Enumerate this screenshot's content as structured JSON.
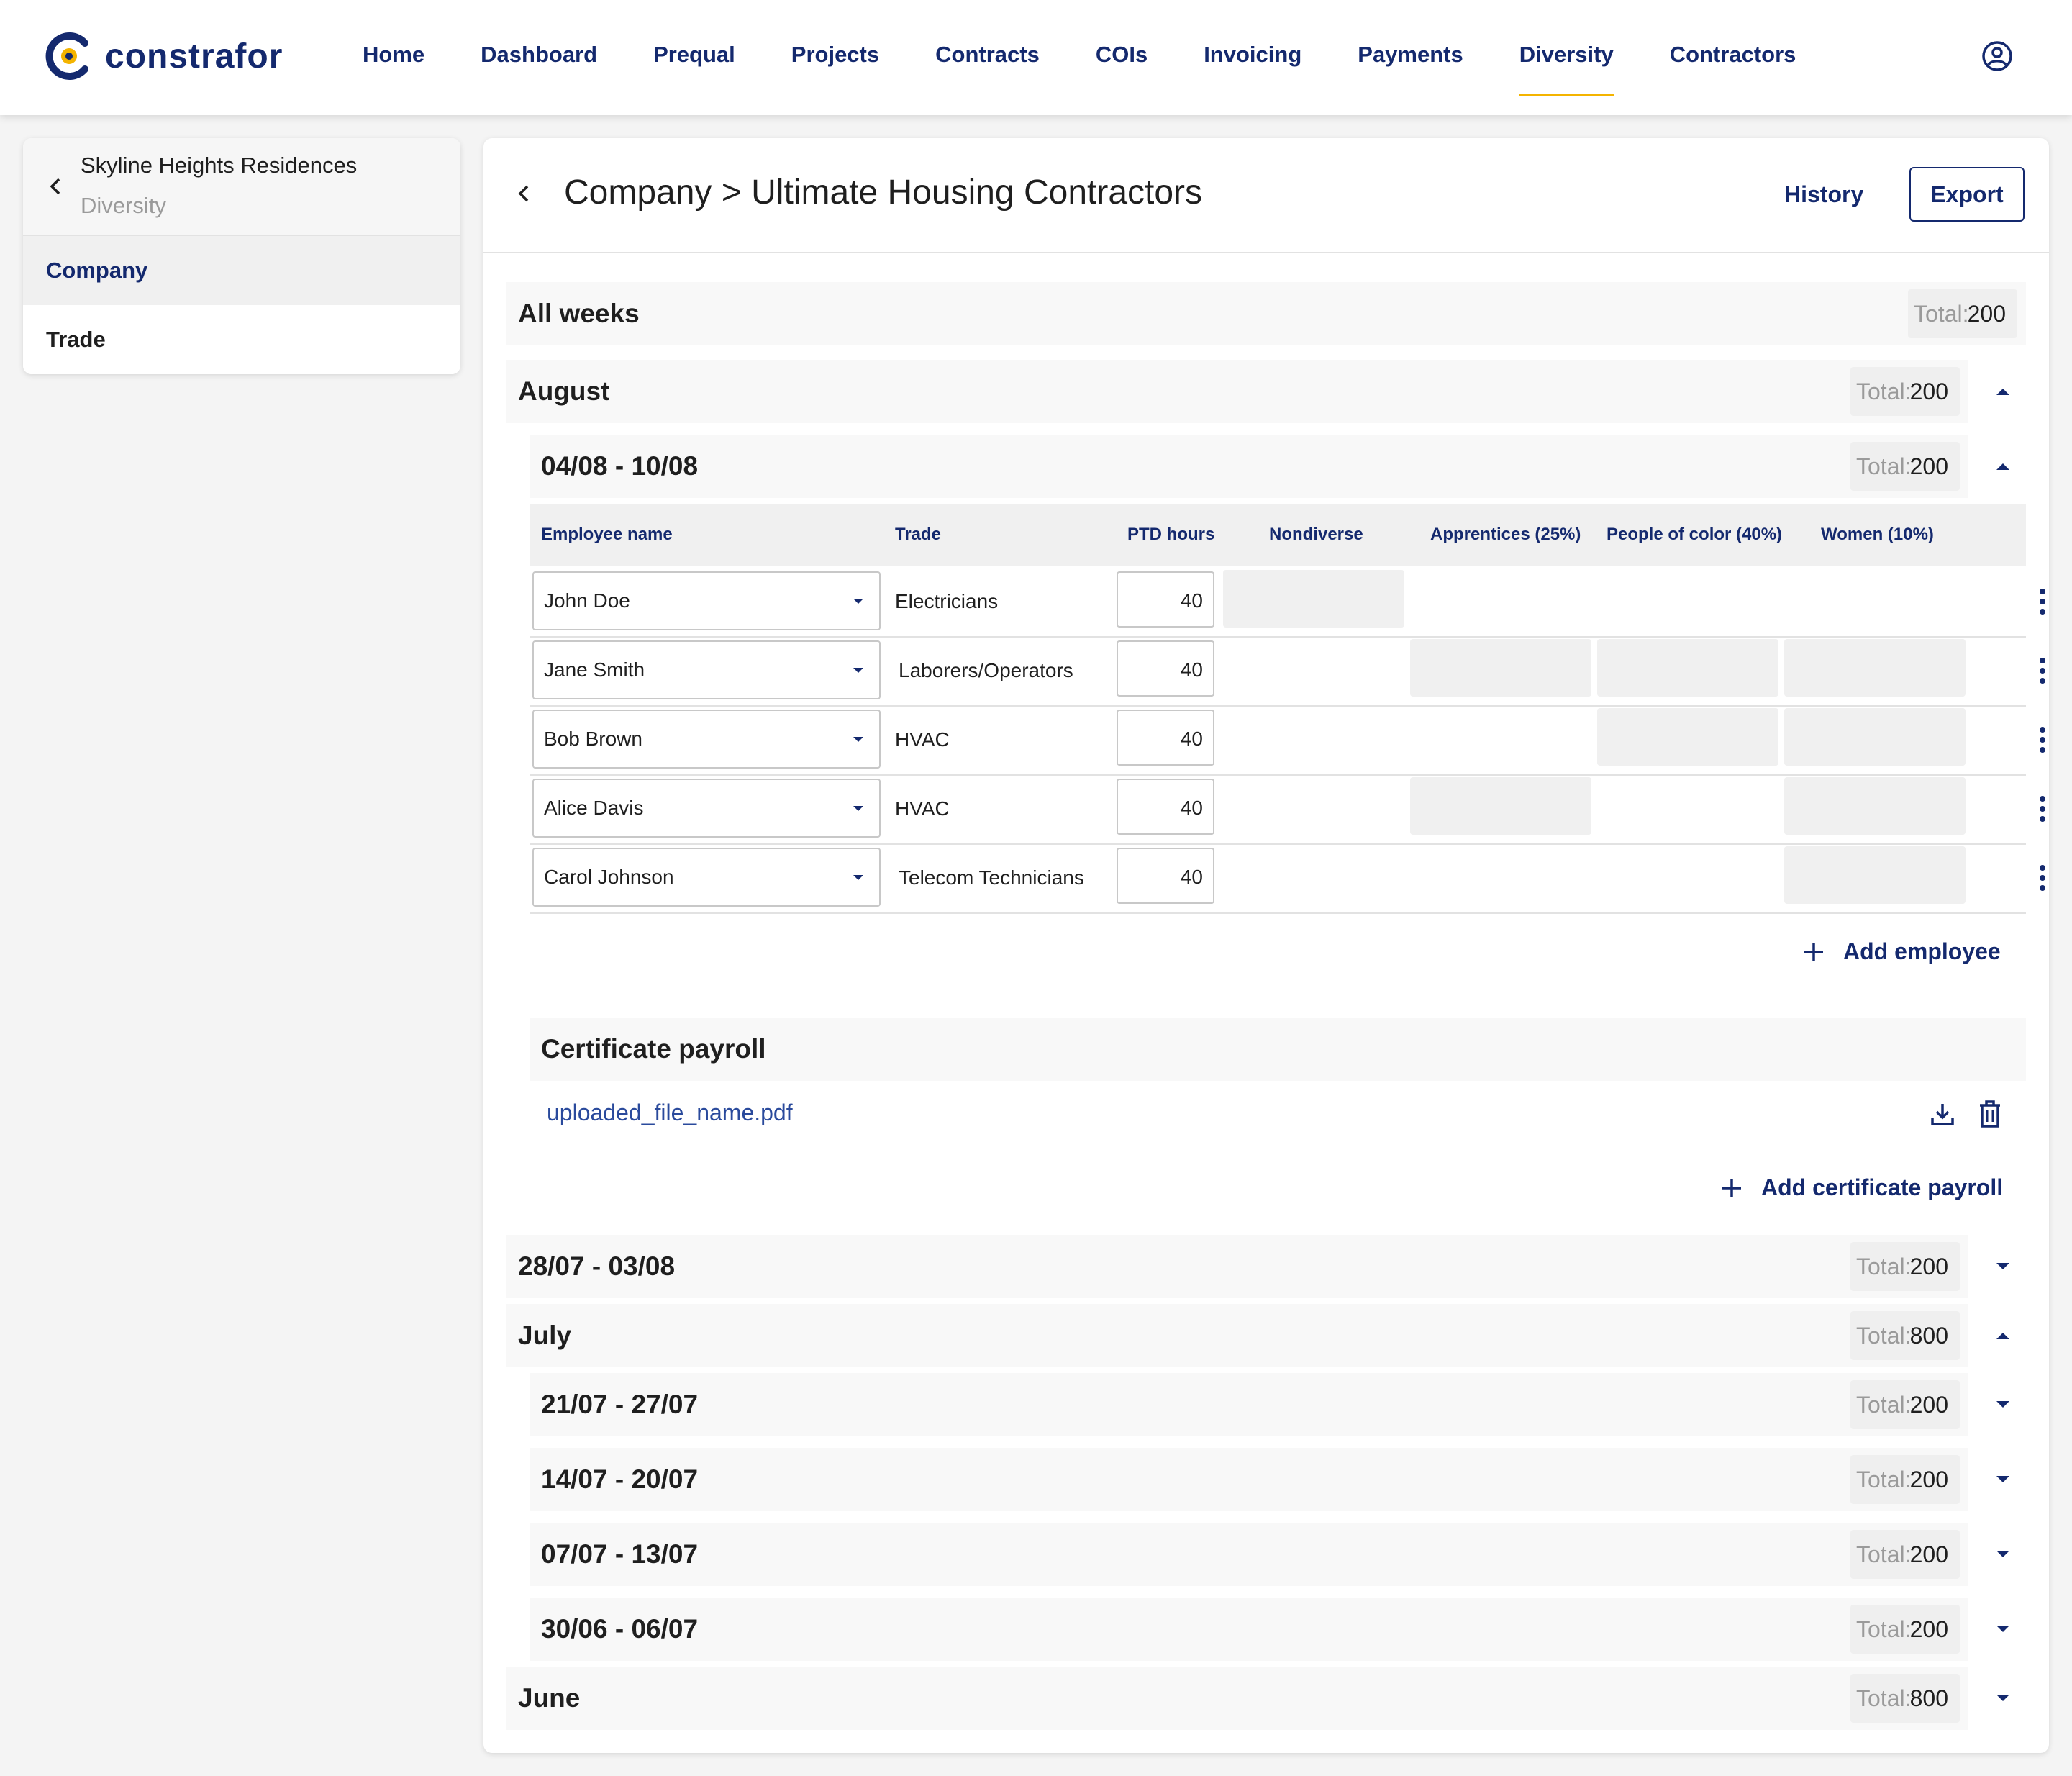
{
  "brand": {
    "name": "constrafor",
    "primary": "#14296e",
    "accent": "#f4b400"
  },
  "nav": {
    "items": [
      {
        "label": "Home"
      },
      {
        "label": "Dashboard"
      },
      {
        "label": "Prequal"
      },
      {
        "label": "Projects"
      },
      {
        "label": "Contracts"
      },
      {
        "label": "COIs"
      },
      {
        "label": "Invoicing"
      },
      {
        "label": "Payments"
      },
      {
        "label": "Diversity",
        "active": true
      },
      {
        "label": "Contractors"
      }
    ],
    "user_icon": "user-circle-icon"
  },
  "sidebar": {
    "title": "Skyline Heights Residences",
    "subtitle": "Diversity",
    "items": [
      {
        "label": "Company",
        "active": true
      },
      {
        "label": "Trade"
      }
    ]
  },
  "header": {
    "title": "Company > Ultimate Housing Contractors",
    "history_label": "History",
    "export_label": "Export"
  },
  "total_label": "Total:",
  "summary": {
    "all_weeks": {
      "label": "All weeks",
      "total": "200"
    },
    "august": {
      "label": "August",
      "total": "200"
    },
    "week_current": {
      "label": "04/08 - 10/08",
      "total": "200"
    }
  },
  "table": {
    "headers": [
      "Employee name",
      "Trade",
      "PTD hours",
      "Nondiverse",
      "Apprentices (25%)",
      "People of color (40%)",
      "Women (10%)"
    ],
    "rows": [
      {
        "employee": "John Doe",
        "trade": "Electricians",
        "hours": "40",
        "nondiverse": true,
        "apprentice": false,
        "poc": false,
        "women": false
      },
      {
        "employee": "Jane Smith",
        "trade": "Laborers/Operators",
        "hours": "40",
        "nondiverse": false,
        "apprentice": true,
        "poc": true,
        "women": true
      },
      {
        "employee": "Bob Brown",
        "trade": "HVAC",
        "hours": "40",
        "nondiverse": false,
        "apprentice": false,
        "poc": true,
        "women": true
      },
      {
        "employee": "Alice Davis",
        "trade": "HVAC",
        "hours": "40",
        "nondiverse": false,
        "apprentice": true,
        "poc": false,
        "women": true
      },
      {
        "employee": "Carol Johnson",
        "trade": "Telecom Technicians",
        "hours": "40",
        "nondiverse": false,
        "apprentice": false,
        "poc": false,
        "women": true
      }
    ]
  },
  "add_employee_label": "Add employee",
  "certificate": {
    "title": "Certificate payroll",
    "file_name": "uploaded_file_name.pdf",
    "add_label": "Add certificate payroll"
  },
  "groups": [
    {
      "label": "28/07 - 03/08",
      "total": "200",
      "expanded": false
    },
    {
      "label": "July",
      "total": "800",
      "expanded": true
    },
    {
      "label": "21/07 - 27/07",
      "total": "200",
      "expanded": false
    },
    {
      "label": "14/07 - 20/07",
      "total": "200",
      "expanded": false
    },
    {
      "label": "07/07 - 13/07",
      "total": "200",
      "expanded": false
    },
    {
      "label": "30/06 - 06/07",
      "total": "200",
      "expanded": false
    },
    {
      "label": "June",
      "total": "800",
      "expanded": false
    }
  ]
}
